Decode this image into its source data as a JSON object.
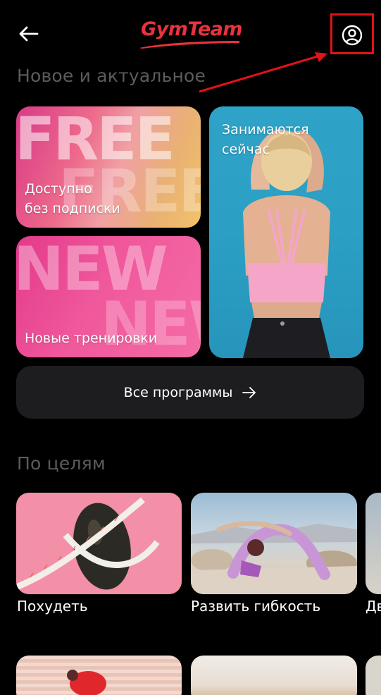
{
  "header": {
    "logo_text": "GymTeam",
    "back_icon": "arrow-left-icon",
    "profile_icon": "user-circle-icon"
  },
  "sections": {
    "new_and_actual": "Новое и актуальное",
    "by_goals": "По целям"
  },
  "cards": {
    "free": {
      "label_line1": "Доступно",
      "label_line2": "без подписки",
      "bg_text": "FREE"
    },
    "new": {
      "label": "Новые тренировки",
      "bg_text": "NEW"
    },
    "now": {
      "label_line1": "Занимаются",
      "label_line2": "сейчас"
    }
  },
  "all_programs": {
    "label": "Все программы",
    "icon": "arrow-right-icon"
  },
  "goals": [
    {
      "label": "Похудеть"
    },
    {
      "label": "Развить гибкость"
    },
    {
      "label": "Дв"
    }
  ],
  "colors": {
    "accent": "#e8323c",
    "annotation": "#e0121a",
    "section_title": "#5c5c5c",
    "button_bg": "#1d1d1f"
  }
}
